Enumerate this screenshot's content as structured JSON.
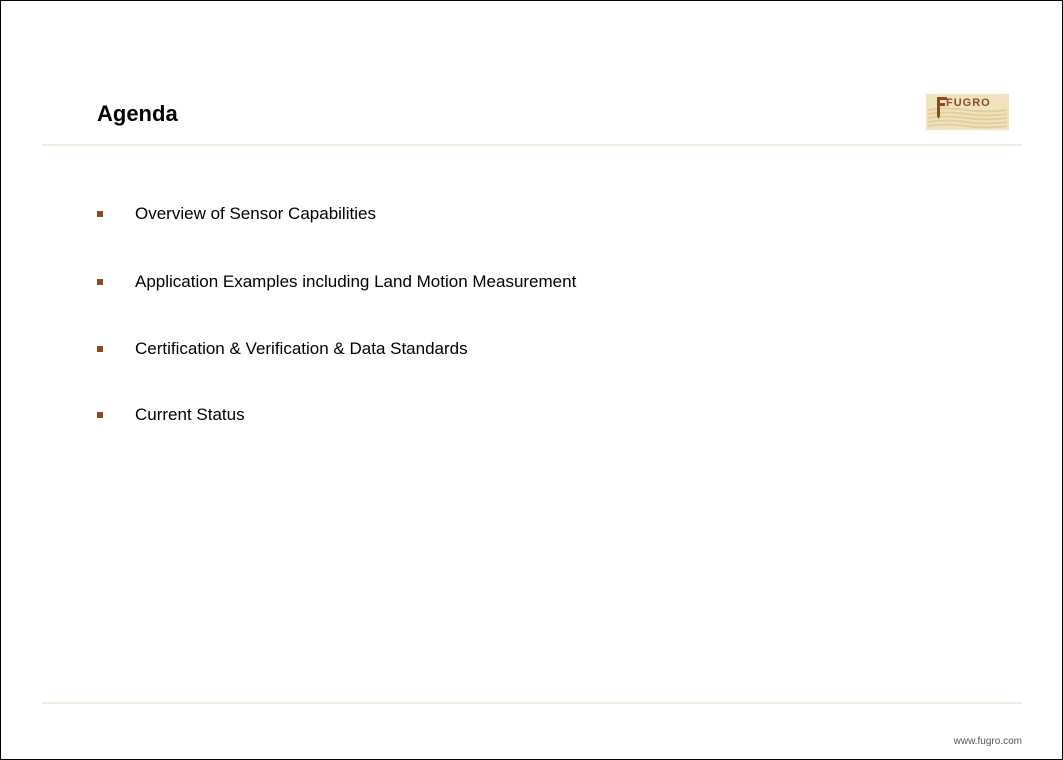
{
  "slide": {
    "title": "Agenda",
    "logo": {
      "text": "FUGRO",
      "colors": {
        "primary": "#8b4b1f",
        "background": "#f0e3bf"
      }
    },
    "agenda_items": [
      "Overview of Sensor Capabilities",
      "Application Examples including Land Motion Measurement",
      "Certification & Verification & Data Standards",
      "Current Status"
    ],
    "footer_url": "www.fugro.com",
    "colors": {
      "bullet": "#8b4b1f",
      "rule": "#f2ebe0"
    }
  }
}
